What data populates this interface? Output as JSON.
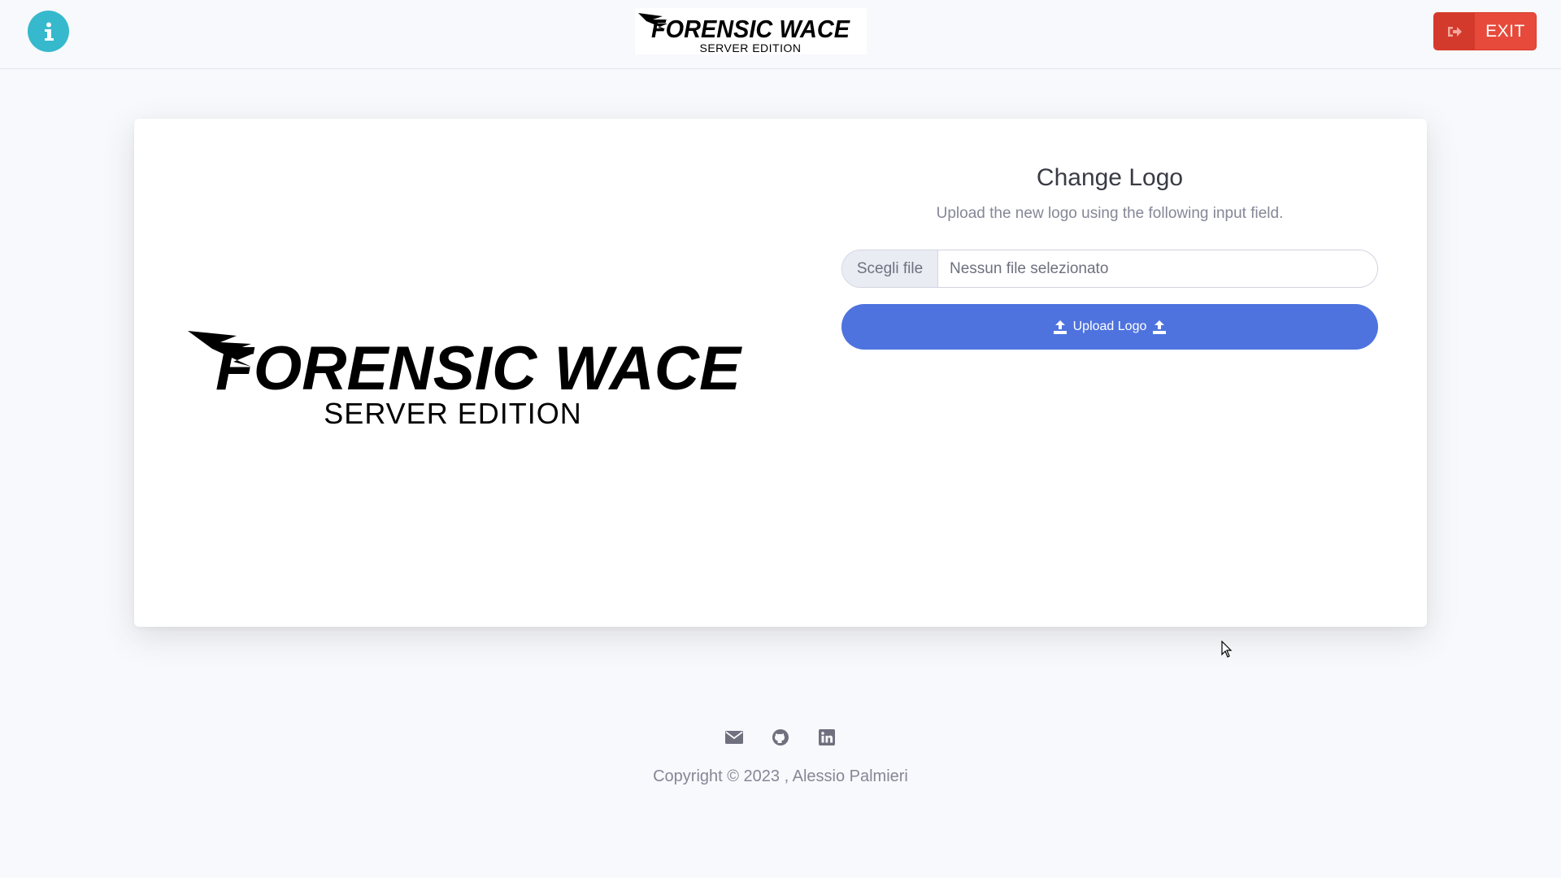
{
  "header": {
    "info_icon": "info-icon",
    "logo": {
      "brand": "FORENSIC WACE",
      "edition": "SERVER EDITION"
    },
    "exit_label": "EXIT",
    "exit_icon": "sign-out-icon"
  },
  "main": {
    "logo": {
      "brand": "FORENSIC WACE",
      "edition": "SERVER EDITION"
    },
    "title": "Change Logo",
    "subtitle": "Upload the new logo using the following input field.",
    "file_input": {
      "button_label": "Scegli file",
      "status": "Nessun file selezionato"
    },
    "upload_button": {
      "label": "Upload Logo",
      "icon": "upload-icon"
    }
  },
  "footer": {
    "icons": [
      "envelope-icon",
      "github-icon",
      "linkedin-icon"
    ],
    "copyright": "Copyright © 2023 , Alessio Palmieri"
  },
  "colors": {
    "background": "#f8f9fc",
    "info": "#36b9cc",
    "danger": "#e74a3b",
    "primary": "#4e73df"
  }
}
